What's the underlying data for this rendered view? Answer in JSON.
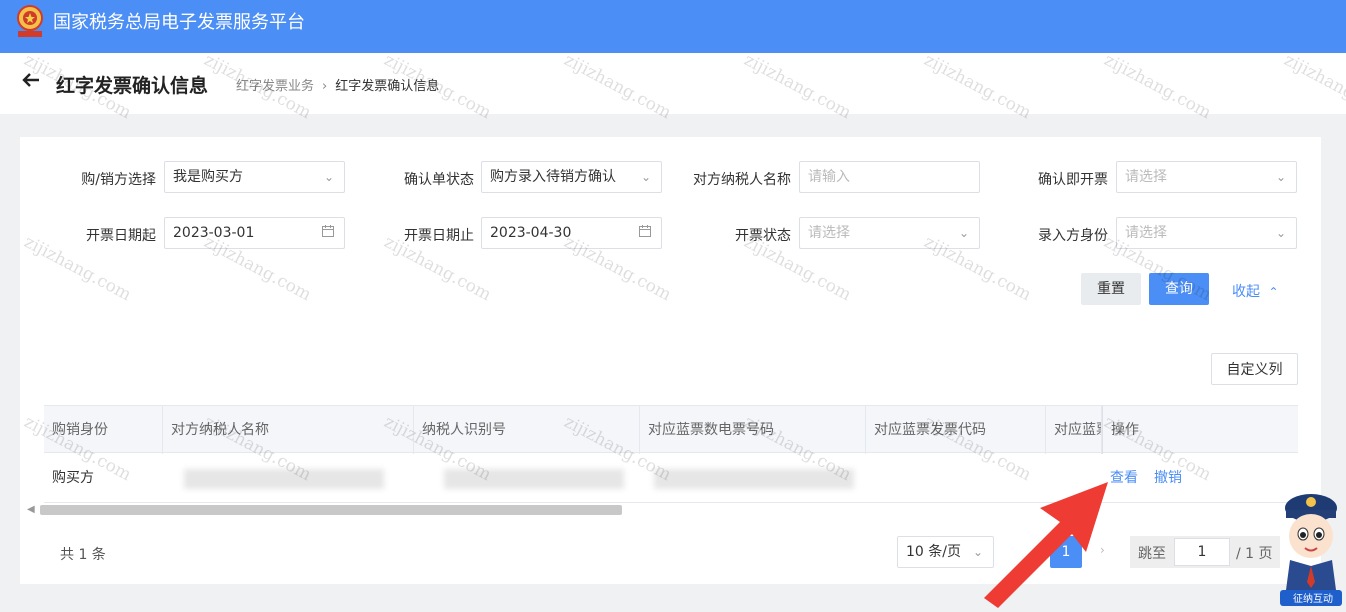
{
  "app": {
    "title": "国家税务总局电子发票服务平台",
    "emblem_text": "中国税务"
  },
  "header": {
    "back_icon": "arrow-left-icon",
    "page_title": "红字发票确认信息",
    "breadcrumb": [
      "红字发票业务",
      "红字发票确认信息"
    ],
    "breadcrumb_separator": "›"
  },
  "filters": {
    "buyer_seller": {
      "label": "购/销方选择",
      "value": "我是购买方"
    },
    "confirm_status": {
      "label": "确认单状态",
      "value": "购方录入待销方确认"
    },
    "counterpart_name": {
      "label": "对方纳税人名称",
      "placeholder": "请输入"
    },
    "confirm_issue": {
      "label": "确认即开票",
      "placeholder": "请选择"
    },
    "date_start": {
      "label": "开票日期起",
      "value": "2023-03-01"
    },
    "date_end": {
      "label": "开票日期止",
      "value": "2023-04-30"
    },
    "issue_status": {
      "label": "开票状态",
      "placeholder": "请选择"
    },
    "entry_identity": {
      "label": "录入方身份",
      "placeholder": "请选择"
    },
    "reset_label": "重置",
    "query_label": "查询",
    "collapse_label": "收起"
  },
  "table": {
    "custom_columns_label": "自定义列",
    "columns": [
      "购销身份",
      "对方纳税人名称",
      "纳税人识别号",
      "对应蓝票数电票号码",
      "对应蓝票发票代码",
      "对应蓝票",
      "操作"
    ],
    "rows": [
      {
        "identity": "购买方",
        "view": "查看",
        "revoke": "撤销"
      }
    ]
  },
  "pagination": {
    "total": "共 1 条",
    "page_size": "10 条/页",
    "current_page": "1",
    "jump_label": "跳至",
    "jump_value": "1",
    "total_pages": "/ 1 页"
  },
  "watermark": "zijizhang.com",
  "mascot_caption": "征纳互动",
  "colors": {
    "primary": "#4b8ef5",
    "annotation_arrow": "#ee3b34"
  }
}
